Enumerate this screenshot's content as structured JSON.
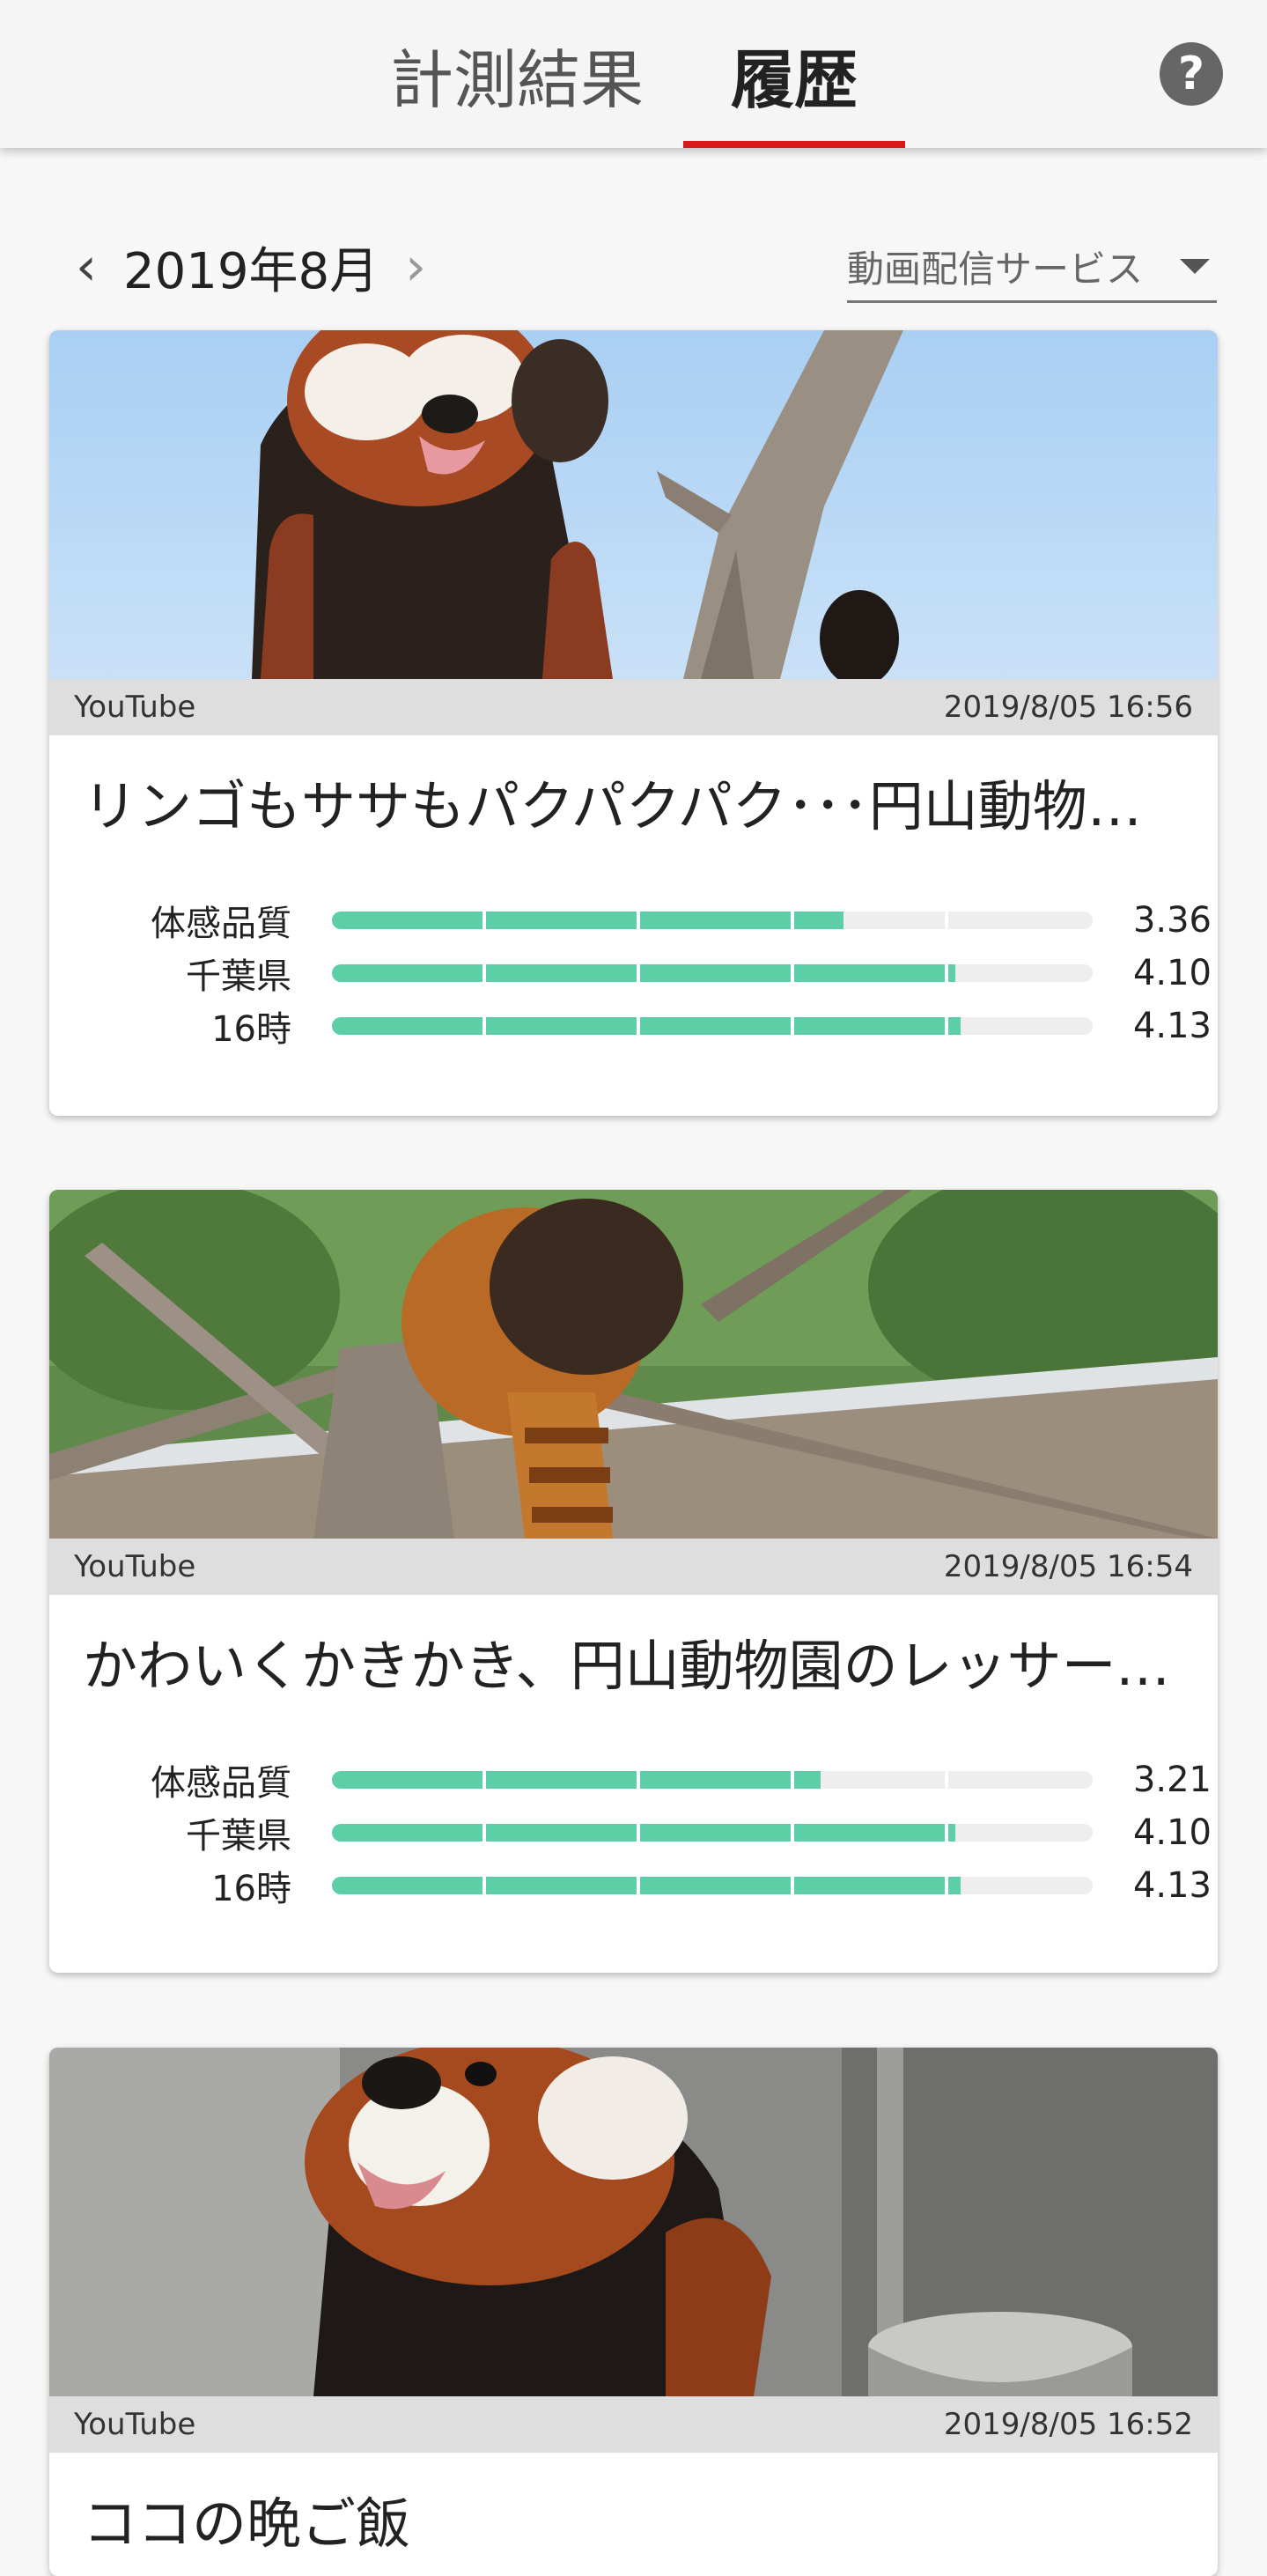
{
  "header": {
    "tabs": [
      {
        "label": "計測結果",
        "active": false
      },
      {
        "label": "履歴",
        "active": true
      }
    ],
    "help_icon": "?",
    "accent_color": "#d7191c"
  },
  "month_nav": {
    "prev": "‹",
    "label": "2019年8月",
    "next": "›"
  },
  "filter": {
    "selected": "動画配信サービス"
  },
  "bar_color": "#5ccfa7",
  "scale_max": 5,
  "history": [
    {
      "service": "YouTube",
      "datetime": "2019/8/05 16:56",
      "title": "リンゴもササもパクパクパク･･･円山動物園のレッサーパンダ",
      "thumbnail": "red-panda-reaching-up-tree",
      "metrics": [
        {
          "label": "体感品質",
          "value": "3.36",
          "score": 3.36
        },
        {
          "label": "千葉県",
          "value": "4.10",
          "score": 4.1
        },
        {
          "label": "16時",
          "value": "4.13",
          "score": 4.13
        }
      ]
    },
    {
      "service": "YouTube",
      "datetime": "2019/8/05 16:54",
      "title": "かわいくかきかき、円山動物園のレッサーパンダ",
      "thumbnail": "red-panda-tail-on-branches",
      "metrics": [
        {
          "label": "体感品質",
          "value": "3.21",
          "score": 3.21
        },
        {
          "label": "千葉県",
          "value": "4.10",
          "score": 4.1
        },
        {
          "label": "16時",
          "value": "4.13",
          "score": 4.13
        }
      ]
    },
    {
      "service": "YouTube",
      "datetime": "2019/8/05 16:52",
      "title": "ココの晩ご飯",
      "thumbnail": "red-panda-at-food-bowl",
      "metrics": []
    }
  ]
}
